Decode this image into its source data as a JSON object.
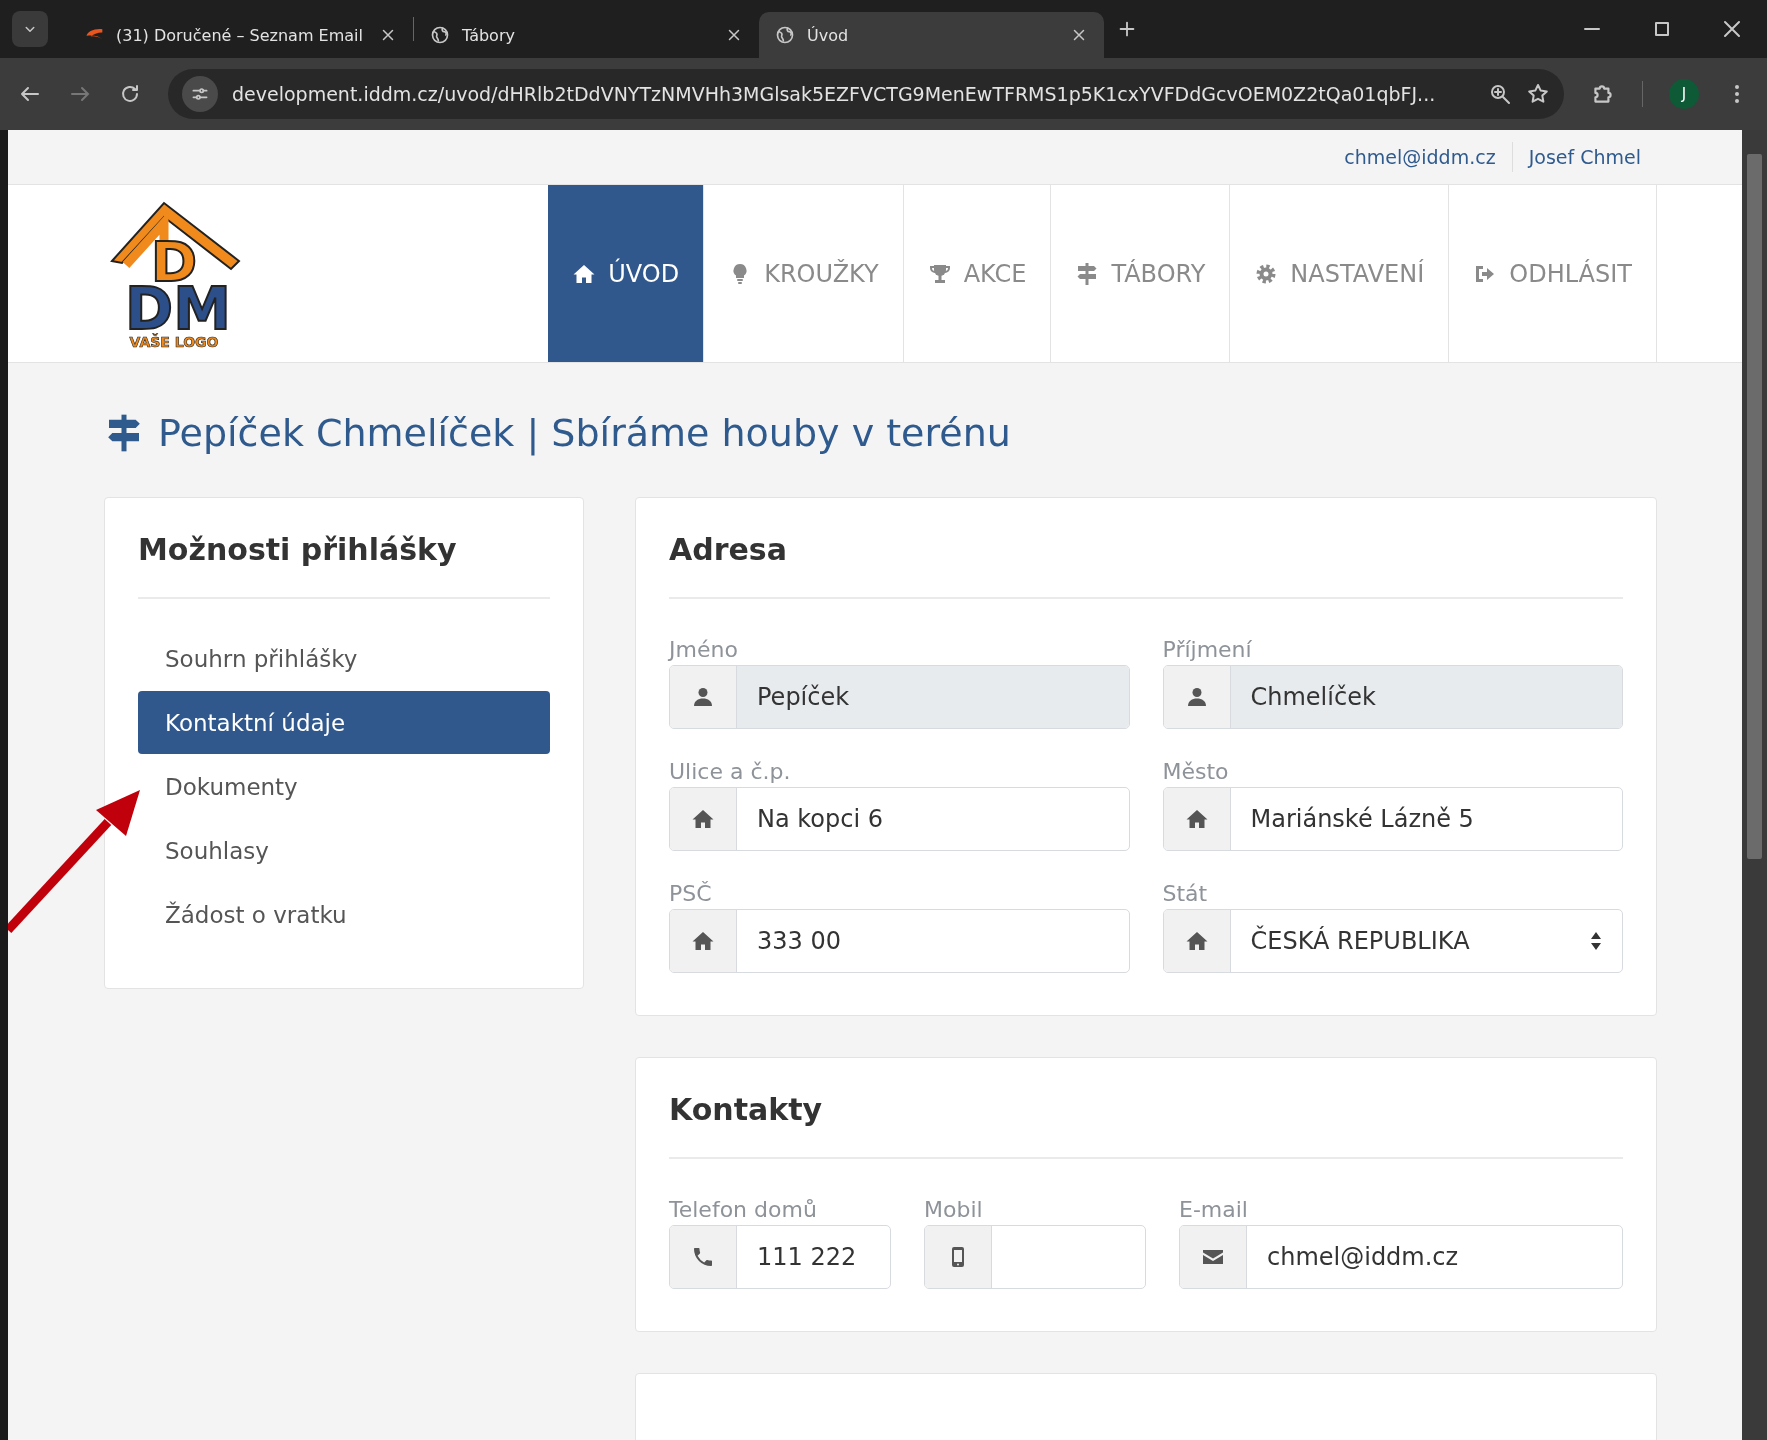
{
  "browser": {
    "tabs": [
      {
        "title": "(31) Doručené – Seznam Email",
        "selected": false
      },
      {
        "title": "Tábory",
        "selected": false
      },
      {
        "title": "Úvod",
        "selected": true
      }
    ],
    "address": "development.iddm.cz/uvod/dHRlb2tDdVNYTzNMVHh3MGlsak5EZFVCTG9MenEwTFRMS1p5K1cxYVFDdGcvOEM0Z2tQa01qbFJ...",
    "profile": "J"
  },
  "account": {
    "email": "chmel@iddm.cz",
    "name": "Josef Chmel"
  },
  "logo": {
    "top": "D",
    "bottom": "DM",
    "caption": "VAŠE LOGO"
  },
  "nav": [
    {
      "label": "ÚVOD",
      "selected": true
    },
    {
      "label": "KROUŽKY",
      "selected": false
    },
    {
      "label": "AKCE",
      "selected": false
    },
    {
      "label": "TÁBORY",
      "selected": false
    },
    {
      "label": "NASTAVENÍ",
      "selected": false
    },
    {
      "label": "ODHLÁSIT",
      "selected": false
    }
  ],
  "page_title": "Pepíček Chmelíček | Sbíráme houby v terénu",
  "sidebar": {
    "title": "Možnosti přihlášky",
    "items": [
      {
        "label": "Souhrn přihlášky",
        "selected": false
      },
      {
        "label": "Kontaktní údaje",
        "selected": true
      },
      {
        "label": "Dokumenty",
        "selected": false
      },
      {
        "label": "Souhlasy",
        "selected": false
      },
      {
        "label": "Žádost o vratku",
        "selected": false
      }
    ]
  },
  "sections": [
    {
      "title": "Adresa",
      "fields": [
        {
          "label": "Jméno",
          "value": "Pepíček",
          "kind": "text",
          "readonly": true
        },
        {
          "label": "Příjmení",
          "value": "Chmelíček",
          "kind": "text",
          "readonly": true
        },
        {
          "label": "Ulice a č.p.",
          "value": "Na kopci 6",
          "kind": "text",
          "readonly": false
        },
        {
          "label": "Město",
          "value": "Mariánské Lázně 5",
          "kind": "text",
          "readonly": false
        },
        {
          "label": "PSČ",
          "value": "333 00",
          "kind": "text",
          "readonly": false
        },
        {
          "label": "Stát",
          "value": "ČESKÁ REPUBLIKA",
          "kind": "select",
          "readonly": false
        }
      ]
    },
    {
      "title": "Kontakty",
      "fields": [
        {
          "label": "Telefon domů",
          "value": "111 222",
          "kind": "text",
          "readonly": false
        },
        {
          "label": "Mobil",
          "kind": "text",
          "readonly": false
        },
        {
          "label": "E-mail",
          "value": "chmel@iddm.cz",
          "kind": "text",
          "readonly": false
        }
      ]
    }
  ]
}
